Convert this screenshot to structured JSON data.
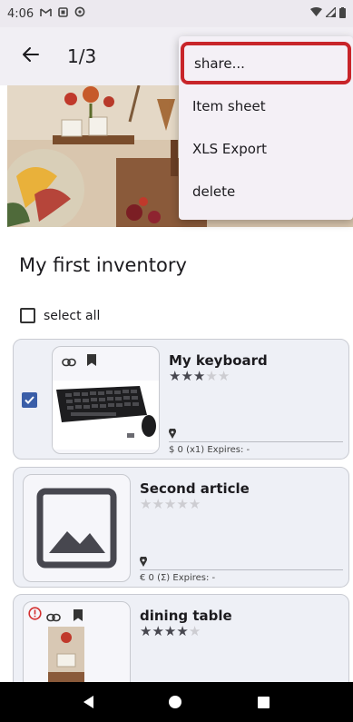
{
  "status_bar": {
    "time": "4:06"
  },
  "app_bar": {
    "page_indicator": "1/3"
  },
  "menu": {
    "items": [
      {
        "label": "share..."
      },
      {
        "label": "Item sheet"
      },
      {
        "label": "XLS Export"
      },
      {
        "label": "delete"
      }
    ]
  },
  "inventory": {
    "title": "My first inventory",
    "select_all_label": "select all",
    "items": [
      {
        "name": "My keyboard",
        "rating": 3,
        "checked": true,
        "meta": "$ 0 (x1)  Expires: -"
      },
      {
        "name": "Second article",
        "rating": 0,
        "checked": false,
        "meta": "€ 0 (Σ)  Expires: -"
      },
      {
        "name": "dining table",
        "rating": 4,
        "checked": false,
        "meta": ""
      }
    ]
  },
  "colors": {
    "accent": "#3a5ea8",
    "highlight": "#c8252a",
    "alert": "#d32f2f"
  }
}
